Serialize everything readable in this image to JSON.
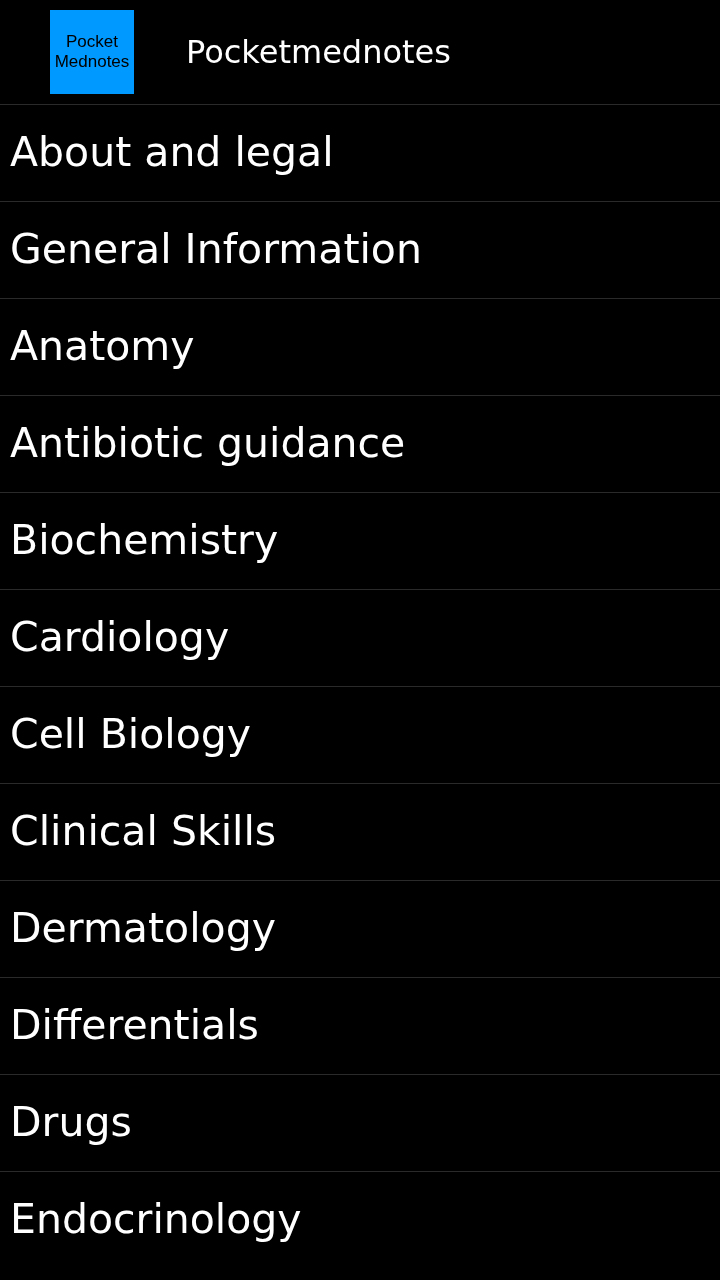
{
  "header": {
    "logo_text": "Pocket Mednotes",
    "title": "Pocketmednotes"
  },
  "menu": {
    "items": [
      {
        "label": "About and legal"
      },
      {
        "label": "General Information"
      },
      {
        "label": "Anatomy"
      },
      {
        "label": "Antibiotic guidance"
      },
      {
        "label": "Biochemistry"
      },
      {
        "label": "Cardiology"
      },
      {
        "label": "Cell Biology"
      },
      {
        "label": "Clinical Skills"
      },
      {
        "label": "Dermatology"
      },
      {
        "label": "Differentials"
      },
      {
        "label": "Drugs"
      },
      {
        "label": "Endocrinology"
      }
    ]
  }
}
